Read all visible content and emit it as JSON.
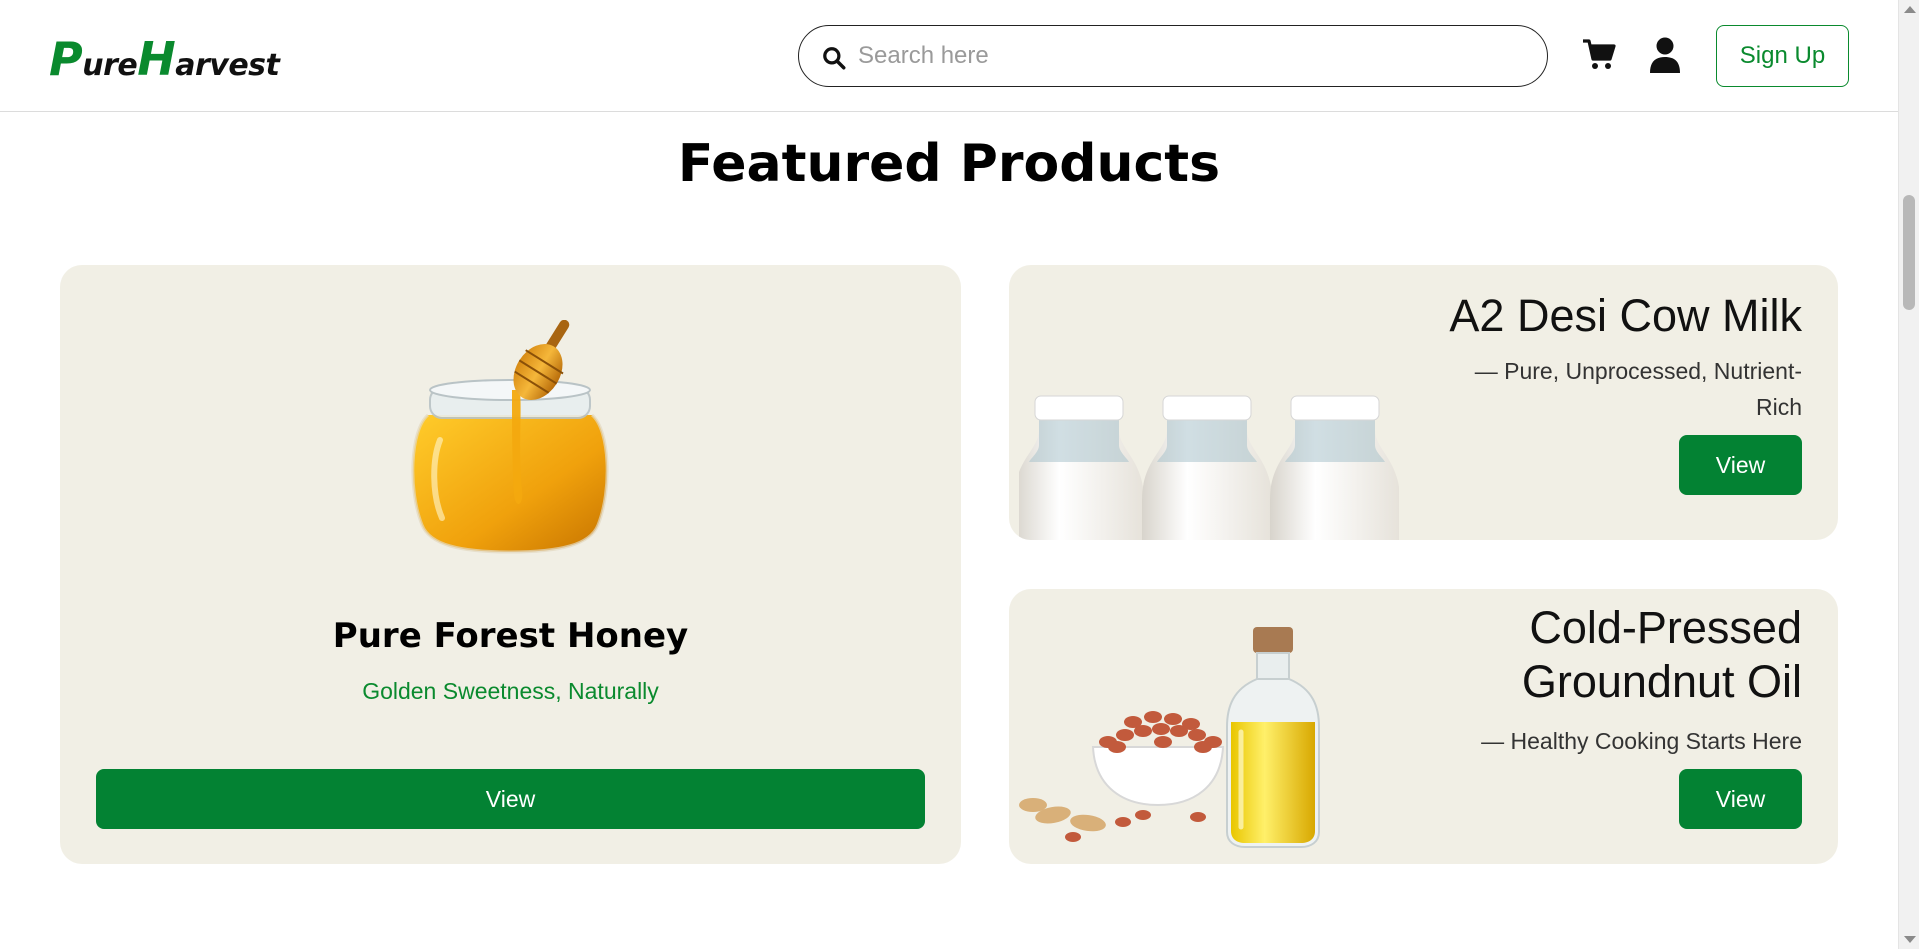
{
  "brand": {
    "logo_p": "P",
    "logo_ure": "ure",
    "logo_h": "H",
    "logo_arvest": "arvest"
  },
  "header": {
    "search_placeholder": "Search here",
    "signup_label": "Sign Up"
  },
  "section": {
    "title": "Featured Products"
  },
  "products": [
    {
      "name": "Pure Forest Honey",
      "tagline": "Golden Sweetness, Naturally",
      "button": "View"
    },
    {
      "name": "A2 Desi Cow Milk",
      "tagline_line1": "— Pure, Unprocessed, Nutrient-",
      "tagline_line2": "Rich",
      "button": "View"
    },
    {
      "name_line1": "Cold-Pressed",
      "name_line2": "Groundnut Oil",
      "tagline": "— Healthy Cooking Starts Here",
      "button": "View"
    }
  ],
  "colors": {
    "brand_green": "#0a8a2e",
    "button_green": "#038233",
    "card_bg": "#f1efe5"
  },
  "icons": [
    "search-icon",
    "cart-icon",
    "user-icon"
  ]
}
